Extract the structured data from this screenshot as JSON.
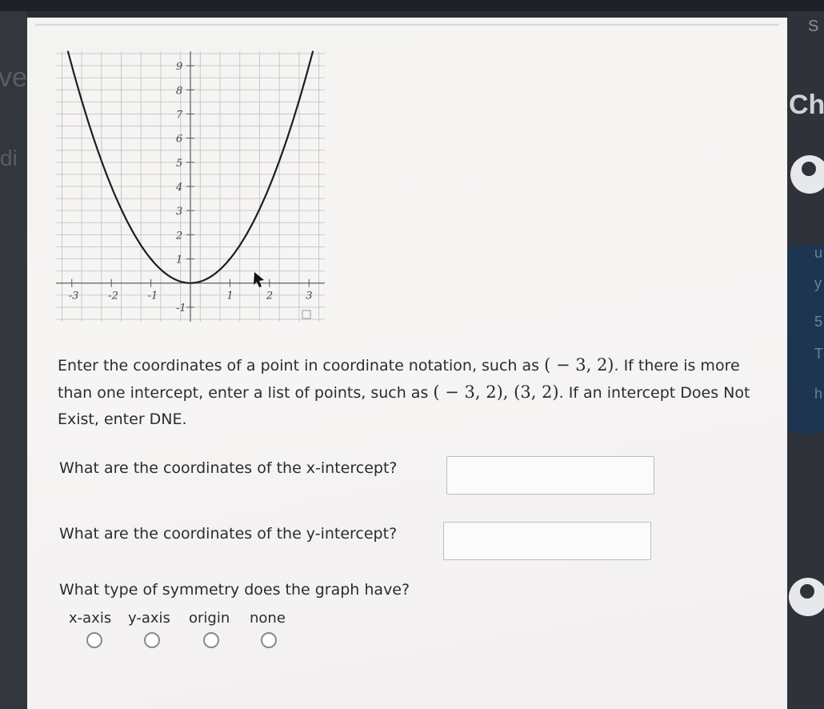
{
  "sidebar_fragments": {
    "left_1": "ve",
    "left_2": "di",
    "right_top": "S",
    "right_ch": "Ch"
  },
  "graph": {
    "x_ticks": [
      "-3",
      "-2",
      "-1",
      "1",
      "2",
      "3"
    ],
    "y_ticks": [
      "9",
      "8",
      "7",
      "6",
      "5",
      "4",
      "3",
      "2",
      "1",
      "-1"
    ],
    "curve": {
      "vertex": [
        0,
        0
      ],
      "points_through": [
        [
          -3,
          9
        ],
        [
          3,
          9
        ]
      ]
    }
  },
  "instructions": {
    "part1": "Enter the coordinates of a point in coordinate notation, such as ",
    "example1": "( − 3, 2)",
    "part2": ". If there is more than one intercept, enter a list of points, such as ",
    "example2": "( − 3, 2), (3, 2)",
    "part3": ". If an intercept Does Not Exist, enter DNE."
  },
  "questions": {
    "x_intercept": {
      "label": "What are the coordinates of the x-intercept?",
      "value": ""
    },
    "y_intercept": {
      "label": "What are the coordinates of the y-intercept?",
      "value": ""
    },
    "symmetry": {
      "label": "What type of symmetry does the graph have?",
      "options": [
        "x-axis",
        "y-axis",
        "origin",
        "none"
      ]
    }
  }
}
